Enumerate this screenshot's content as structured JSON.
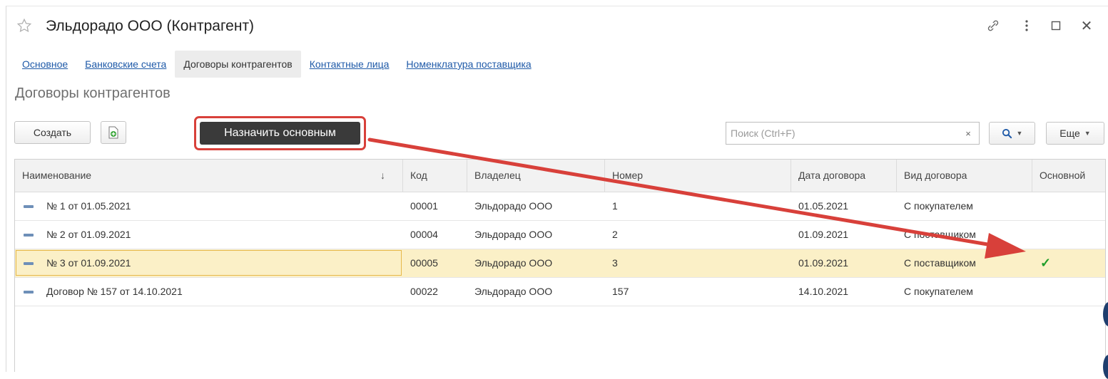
{
  "window": {
    "title": "Эльдорадо ООО (Контрагент)",
    "close_glyph": "✕"
  },
  "tabs": [
    {
      "label": "Основное",
      "active": false
    },
    {
      "label": "Банковские счета",
      "active": false
    },
    {
      "label": "Договоры контрагентов",
      "active": true
    },
    {
      "label": "Контактные лица",
      "active": false
    },
    {
      "label": "Номенклатура поставщика",
      "active": false
    }
  ],
  "section": {
    "title": "Договоры контрагентов"
  },
  "toolbar": {
    "create_label": "Создать",
    "assign_label": "Назначить основным",
    "search_placeholder": "Поиск (Ctrl+F)",
    "clear_glyph": "×",
    "more_label": "Еще"
  },
  "table": {
    "columns": [
      "Наименование",
      "Код",
      "Владелец",
      "Номер",
      "Дата договора",
      "Вид договора",
      "Основной"
    ],
    "sort_glyph": "↓",
    "rows": [
      {
        "name": "№ 1 от 01.05.2021",
        "code": "00001",
        "owner": "Эльдорадо ООО",
        "number": "1",
        "date": "01.05.2021",
        "kind": "С покупателем",
        "main": ""
      },
      {
        "name": "№ 2 от 01.09.2021",
        "code": "00004",
        "owner": "Эльдорадо ООО",
        "number": "2",
        "date": "01.09.2021",
        "kind": "С поставщиком",
        "main": ""
      },
      {
        "name": "№ 3 от 01.09.2021",
        "code": "00005",
        "owner": "Эльдорадо ООО",
        "number": "3",
        "date": "01.09.2021",
        "kind": "С поставщиком",
        "main": "✓"
      },
      {
        "name": "Договор № 157 от 14.10.2021",
        "code": "00022",
        "owner": "Эльдорадо ООО",
        "number": "157",
        "date": "14.10.2021",
        "kind": "С покупателем",
        "main": ""
      }
    ],
    "selected_row": 2
  },
  "colors": {
    "accent_link": "#1f5aa8",
    "annotation_red": "#d8403a",
    "check_green": "#1f9d2a",
    "selected_row": "#fbf0c7"
  },
  "icons": [
    "star-icon",
    "link-icon",
    "more-vertical-icon",
    "maximize-icon",
    "close-icon",
    "add-file-icon",
    "search-icon",
    "contract-row-icon",
    "check-icon"
  ]
}
